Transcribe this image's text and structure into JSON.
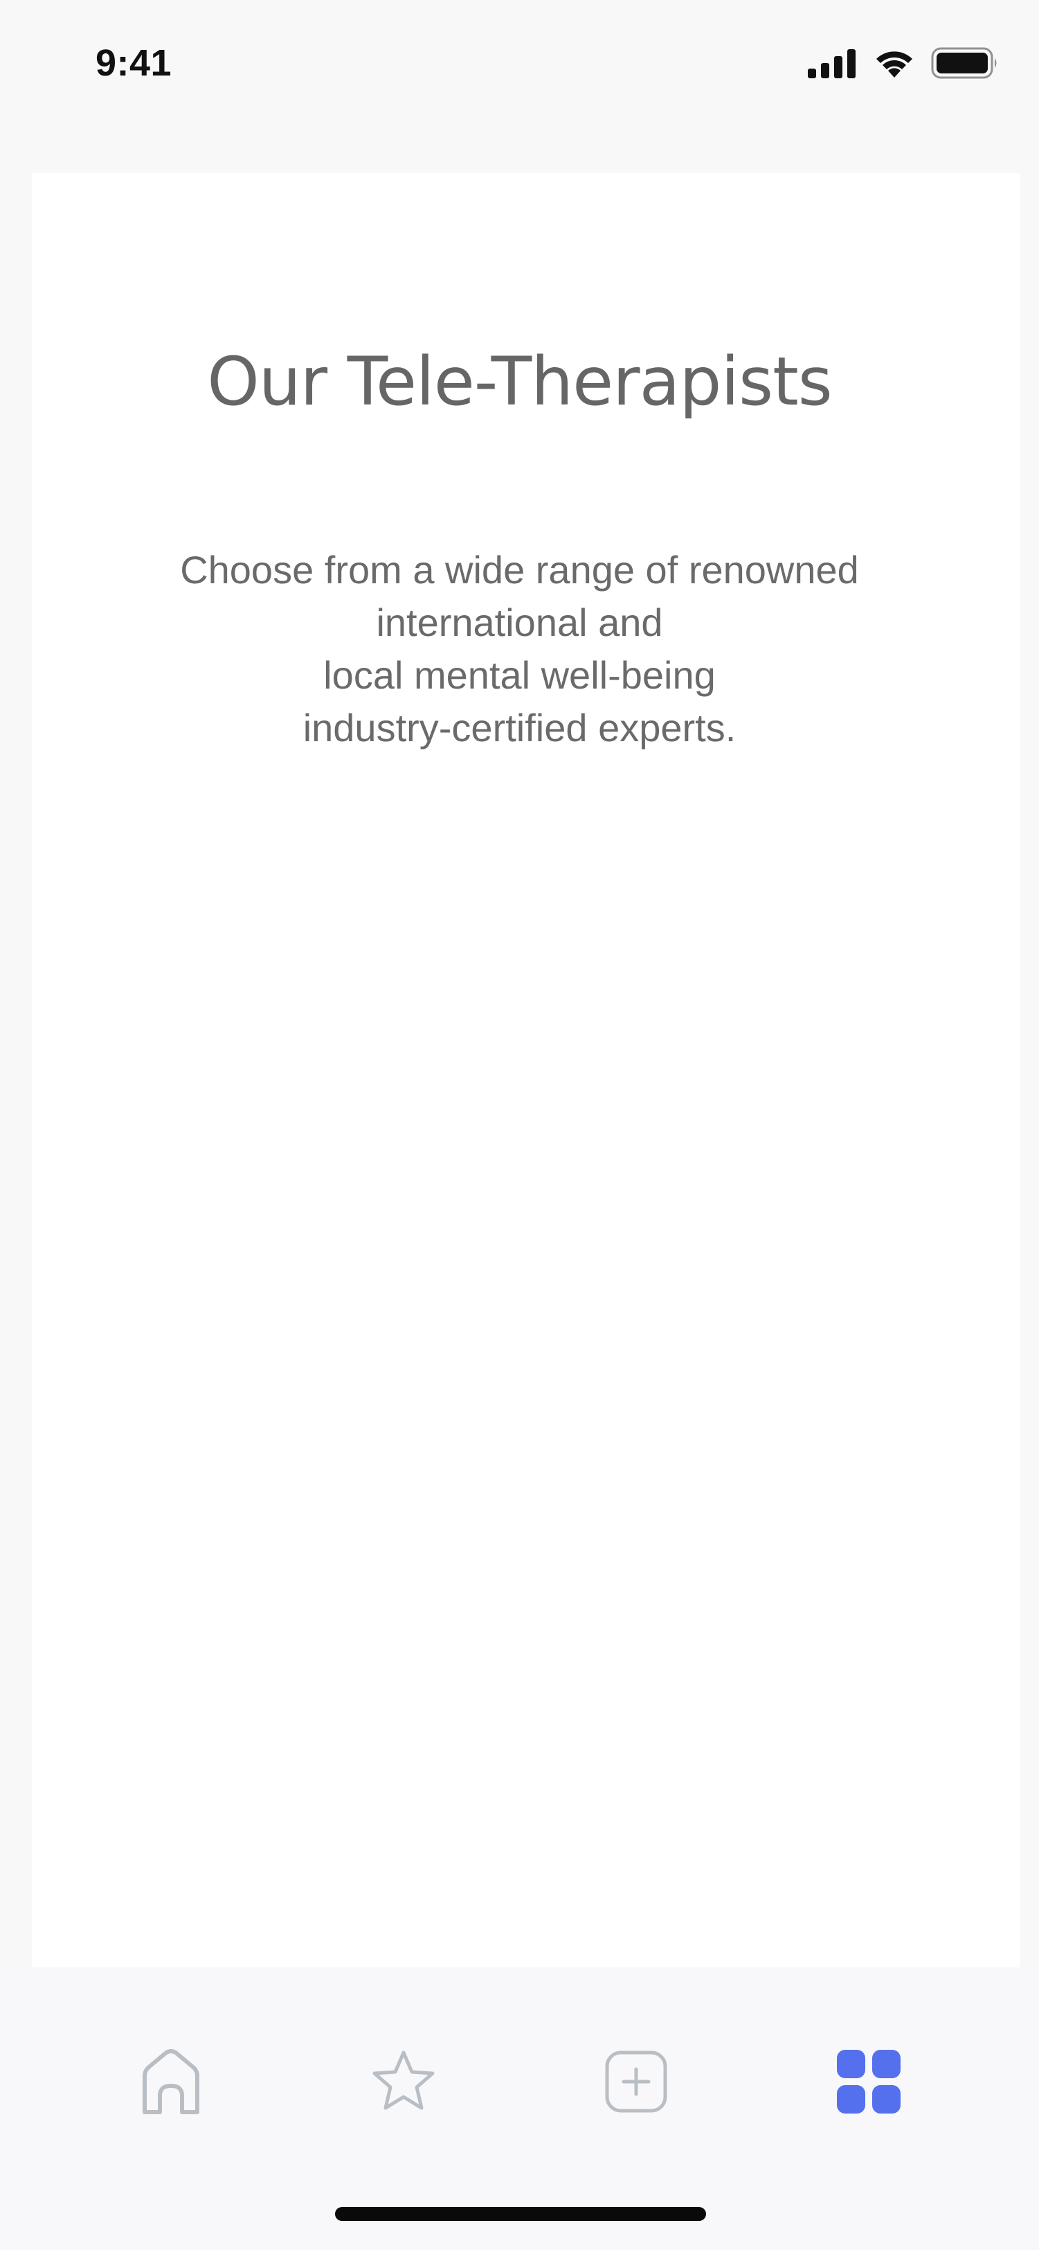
{
  "status_bar": {
    "time": "9:41",
    "icons": [
      "cellular-signal-icon",
      "wifi-icon",
      "battery-icon"
    ]
  },
  "content": {
    "title": "Our Tele-Therapists",
    "description_lines": [
      "Choose from a wide range of renowned",
      "international and",
      "local mental well-being",
      "industry-certified experts."
    ]
  },
  "tab_bar": {
    "tabs": [
      {
        "icon": "home-icon",
        "active": false
      },
      {
        "icon": "star-icon",
        "active": false
      },
      {
        "icon": "add-square-icon",
        "active": false
      },
      {
        "icon": "grid-icon",
        "active": true
      }
    ],
    "colors": {
      "active": "#5570ec",
      "inactive": "#b9bec4"
    }
  },
  "colors": {
    "background": "#f8f8f9",
    "card": "#ffffff",
    "title_text": "#666666",
    "body_text": "#6a6a6a"
  }
}
